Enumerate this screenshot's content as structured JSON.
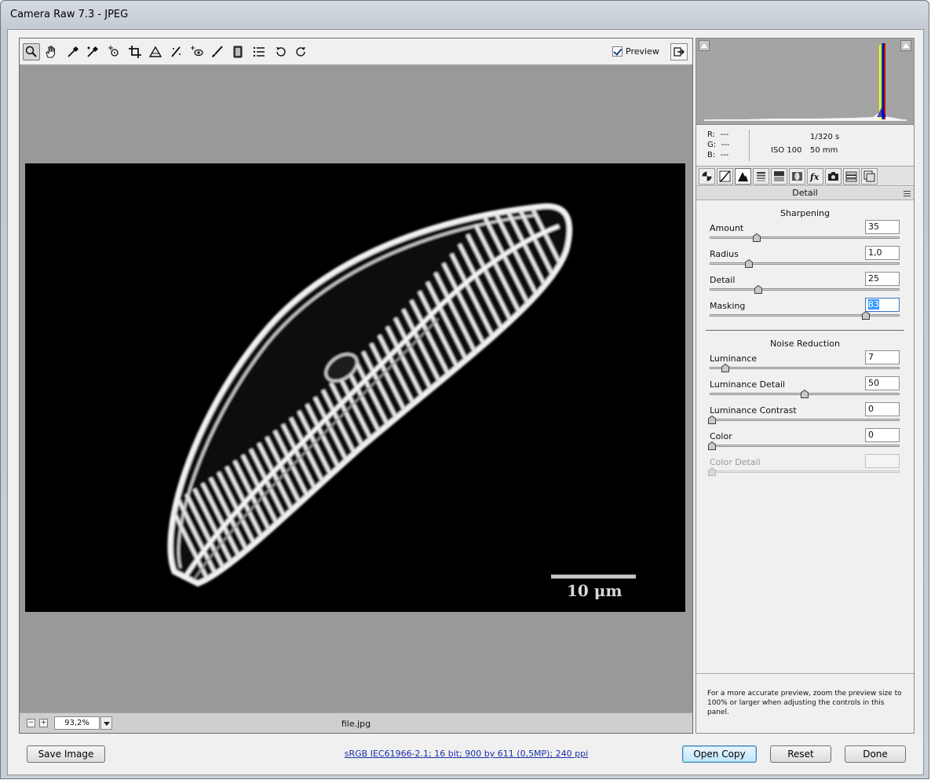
{
  "window": {
    "title": "Camera Raw 7.3  -  JPEG"
  },
  "toolbar": {
    "tools": [
      "zoom-icon",
      "hand-icon",
      "white-balance-icon",
      "color-sampler-icon",
      "target-adjustment-icon",
      "crop-icon",
      "straighten-icon",
      "spot-removal-icon",
      "red-eye-icon",
      "adjustment-brush-icon",
      "graduated-filter-icon",
      "preferences-icon",
      "rotate-left-icon",
      "rotate-right-icon"
    ],
    "preview_label": "Preview",
    "preview_checked": true
  },
  "preview": {
    "scale_bar_label": "10 μm"
  },
  "statusbar": {
    "zoom_out": "−",
    "zoom_in": "+",
    "zoom_value": "93,2%",
    "filename": "file.jpg"
  },
  "info": {
    "r_label": "R:",
    "r_value": "---",
    "g_label": "G:",
    "g_value": "---",
    "b_label": "B:",
    "b_value": "---",
    "shutter": "1/320 s",
    "iso": "ISO 100",
    "focal_length": "50 mm"
  },
  "tabs": [
    "basic-icon",
    "tone-curve-icon",
    "detail-icon",
    "hsl-icon",
    "split-toning-icon",
    "lens-corrections-icon",
    "effects-icon",
    "camera-calibration-icon",
    "presets-icon",
    "snapshots-icon"
  ],
  "panel": {
    "title": "Detail",
    "sharpening": {
      "heading": "Sharpening",
      "amount": {
        "label": "Amount",
        "value": "35",
        "fraction": 0.24
      },
      "radius": {
        "label": "Radius",
        "value": "1,0",
        "fraction": 0.2
      },
      "detail": {
        "label": "Detail",
        "value": "25",
        "fraction": 0.25
      },
      "masking": {
        "label": "Masking",
        "value": "83",
        "fraction": 0.83
      }
    },
    "noise_reduction": {
      "heading": "Noise Reduction",
      "luminance": {
        "label": "Luminance",
        "value": "7",
        "fraction": 0.07
      },
      "luminance_detail": {
        "label": "Luminance Detail",
        "value": "50",
        "fraction": 0.5
      },
      "luminance_contrast": {
        "label": "Luminance Contrast",
        "value": "0",
        "fraction": 0
      },
      "color": {
        "label": "Color",
        "value": "0",
        "fraction": 0
      },
      "color_detail": {
        "label": "Color Detail",
        "value": "",
        "fraction": 0
      }
    },
    "help_text": "For a more accurate preview, zoom the preview size to 100% or larger when adjusting the controls in this panel."
  },
  "buttons": {
    "save_image": "Save Image",
    "open_copy": "Open Copy",
    "reset": "Reset",
    "done": "Done"
  },
  "workflow_options": "sRGB IEC61966-2.1; 16 bit; 900 by 611 (0,5MP); 240 ppi",
  "colors": {
    "panel_bg": "#f0f0f0",
    "preview_bg": "#999999",
    "default_button": "#bee6fd"
  }
}
